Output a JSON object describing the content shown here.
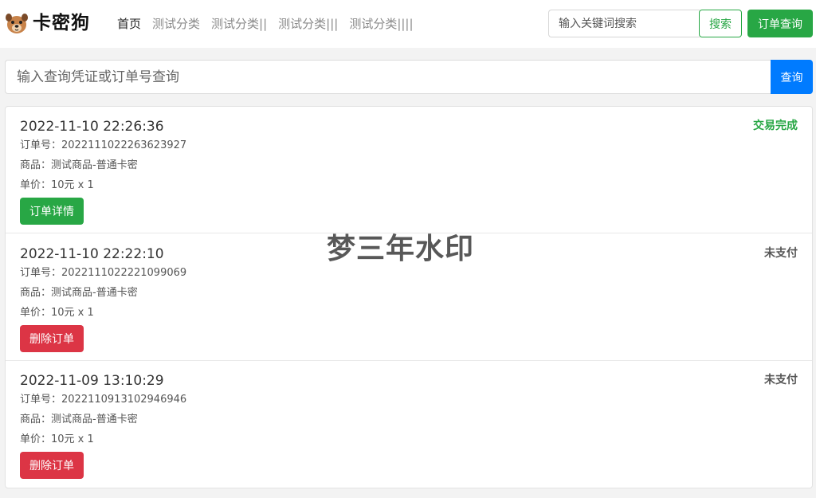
{
  "brand": {
    "name": "卡密狗",
    "logo_icon": "dog-face-icon"
  },
  "nav": {
    "items": [
      {
        "label": "首页",
        "active": true
      },
      {
        "label": "测试分类",
        "active": false
      },
      {
        "label": "测试分类||",
        "active": false
      },
      {
        "label": "测试分类|||",
        "active": false
      },
      {
        "label": "测试分类||||",
        "active": false
      }
    ]
  },
  "header_search": {
    "placeholder": "输入关键词搜索",
    "search_label": "搜索",
    "order_query_label": "订单查询"
  },
  "query": {
    "placeholder": "输入查询凭证或订单号查询",
    "button_label": "查询"
  },
  "orders": [
    {
      "time": "2022-11-10 22:26:36",
      "status": "交易完成",
      "status_color": "#28a745",
      "order_no": "订单号：2022111022263623927",
      "product": "商品：测试商品-普通卡密",
      "price": "单价：10元 x 1",
      "action_label": "订单详情",
      "action_color": "#28a745"
    },
    {
      "time": "2022-11-10 22:22:10",
      "status": "未支付",
      "status_color": "#555555",
      "order_no": "订单号：2022111022221099069",
      "product": "商品：测试商品-普通卡密",
      "price": "单价：10元 x 1",
      "action_label": "删除订单",
      "action_color": "#dc3545"
    },
    {
      "time": "2022-11-09 13:10:29",
      "status": "未支付",
      "status_color": "#555555",
      "order_no": "订单号：2022110913102946946",
      "product": "商品：测试商品-普通卡密",
      "price": "单价：10元 x 1",
      "action_label": "删除订单",
      "action_color": "#dc3545"
    }
  ],
  "watermark": "梦三年水印",
  "colors": {
    "primary": "#007bff",
    "success": "#28a745",
    "danger": "#dc3545"
  }
}
